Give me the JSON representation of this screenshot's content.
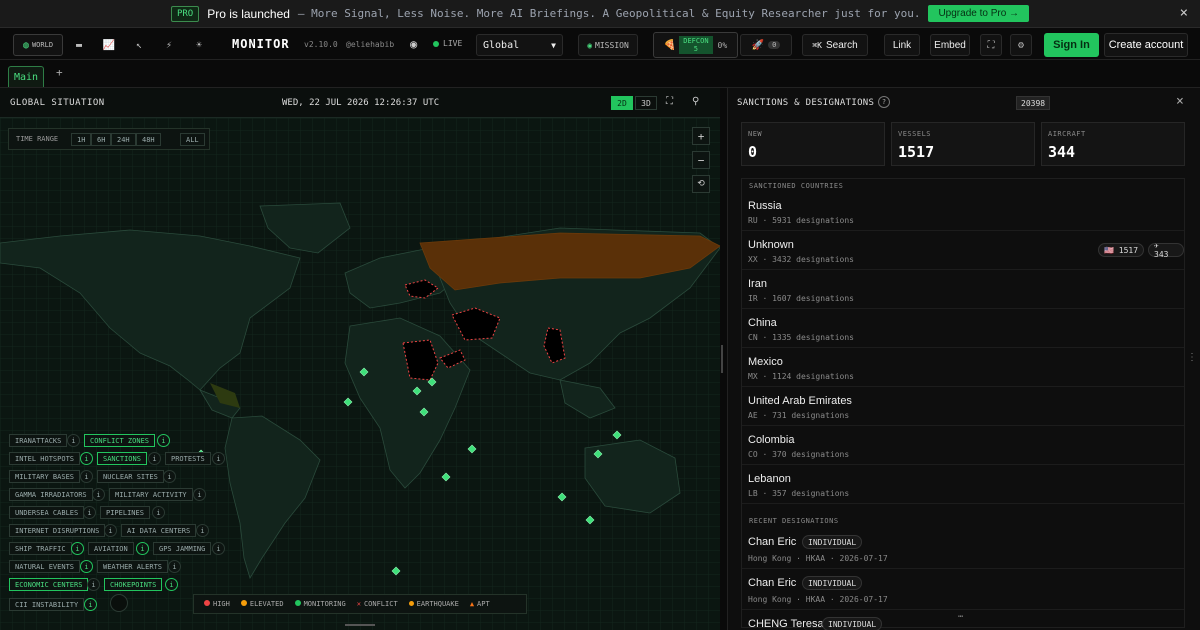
{
  "banner": {
    "pro_tag": "PRO",
    "title": "Pro is launched",
    "desc": "— More Signal, Less Noise. More AI Briefings. A Geopolitical & Equity Researcher just for you.",
    "upgrade": "Upgrade to Pro →",
    "close": "×"
  },
  "topbar": {
    "world": "WORLD",
    "app": "MONITOR",
    "version": "v2.10.0",
    "handle": "@eliehabib",
    "live": "LIVE",
    "region": "Global",
    "mission": "MISSION",
    "defcon": "DEFCON",
    "defcon_level": "5",
    "defcon_pct": "0%",
    "alert_count": "0",
    "search": "Search",
    "search_key": "⌘K",
    "link": "Link",
    "embed": "Embed",
    "signin": "Sign In",
    "create": "Create account"
  },
  "tabs": {
    "main": "Main",
    "add": "+"
  },
  "map": {
    "title": "GLOBAL SITUATION",
    "datetime": "WED, 22 JUL 2026 12:26:37 UTC",
    "mode2d": "2D",
    "mode3d": "3D",
    "time_range_label": "TIME RANGE",
    "ranges": [
      "1H",
      "6H",
      "24H",
      "48H"
    ],
    "all": "ALL",
    "layers": {
      "iranattacks": "IRANATTACKS",
      "conflict_zones": "CONFLICT ZONES",
      "intel_hotspots": "INTEL HOTSPOTS",
      "sanctions": "SANCTIONS",
      "protests": "PROTESTS",
      "military_bases": "MILITARY BASES",
      "nuclear_sites": "NUCLEAR SITES",
      "gamma": "GAMMA IRRADIATORS",
      "military_activity": "MILITARY ACTIVITY",
      "undersea": "UNDERSEA CABLES",
      "pipelines": "PIPELINES",
      "internet": "INTERNET DISRUPTIONS",
      "ai_dc": "AI DATA CENTERS",
      "ship": "SHIP TRAFFIC",
      "aviation": "AVIATION",
      "gps": "GPS JAMMING",
      "natural": "NATURAL EVENTS",
      "weather": "WEATHER ALERTS",
      "economic": "ECONOMIC CENTERS",
      "chokepoints": "CHOKEPOINTS",
      "cii": "CII INSTABILITY"
    },
    "legend": {
      "high": "HIGH",
      "elevated": "ELEVATED",
      "monitoring": "MONITORING",
      "conflict": "CONFLICT",
      "earthquake": "EARTHQUAKE",
      "apt": "APT"
    },
    "colors": {
      "high": "#ef4444",
      "elevated": "#f59e0b",
      "monitoring": "#22c55e",
      "conflict": "#ef4444",
      "earthquake": "#f59e0b",
      "apt": "#f97316"
    }
  },
  "panel": {
    "title": "SANCTIONS & DESIGNATIONS",
    "count": "20398",
    "stats": {
      "new_label": "NEW",
      "new": "0",
      "vessels_label": "VESSELS",
      "vessels": "1517",
      "aircraft_label": "AIRCRAFT",
      "aircraft": "344"
    },
    "countries_label": "SANCTIONED COUNTRIES",
    "countries": [
      {
        "name": "Russia",
        "meta": "RU · 5931 designations"
      },
      {
        "name": "Unknown",
        "meta": "XX · 3432 designations",
        "b1": "🇺🇸 1517",
        "b2": "✈ 343"
      },
      {
        "name": "Iran",
        "meta": "IR · 1607 designations"
      },
      {
        "name": "China",
        "meta": "CN · 1335 designations"
      },
      {
        "name": "Mexico",
        "meta": "MX · 1124 designations"
      },
      {
        "name": "United Arab Emirates",
        "meta": "AE · 731 designations"
      },
      {
        "name": "Colombia",
        "meta": "CO · 370 designations"
      },
      {
        "name": "Lebanon",
        "meta": "LB · 357 designations"
      }
    ],
    "recent_label": "RECENT DESIGNATIONS",
    "recent": [
      {
        "name": "Chan Eric",
        "type": "INDIVIDUAL",
        "meta": "Hong Kong · HKAA · 2026-07-17"
      },
      {
        "name": "Chan Eric",
        "type": "INDIVIDUAL",
        "meta": "Hong Kong · HKAA · 2026-07-17"
      },
      {
        "name": "CHENG Teresa",
        "type": "INDIVIDUAL"
      }
    ]
  }
}
